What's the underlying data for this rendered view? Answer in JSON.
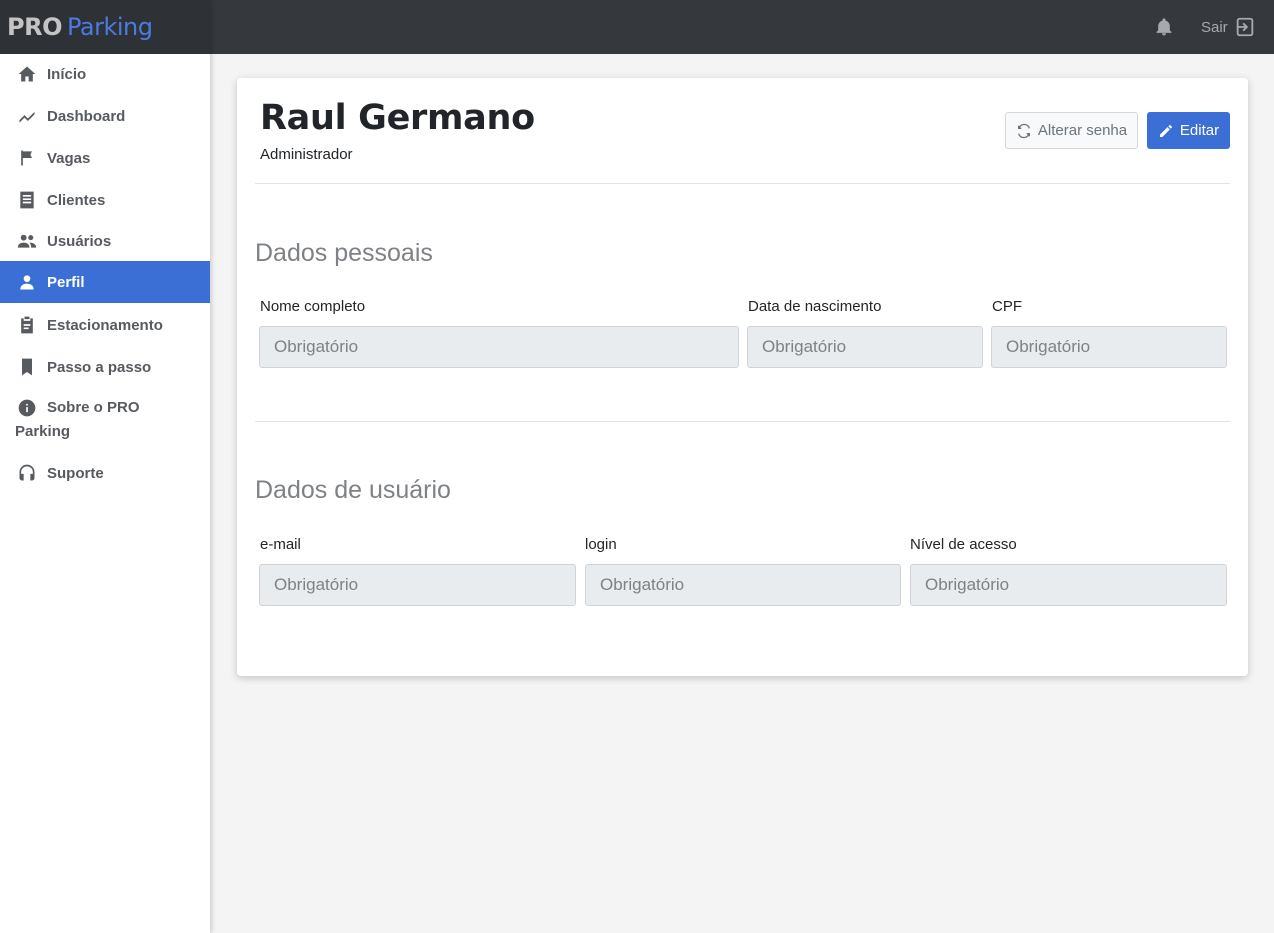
{
  "brand": {
    "pro": "PRO",
    "parking": "Parking"
  },
  "sidebar": {
    "items": [
      {
        "label": "Início",
        "icon": "home-icon"
      },
      {
        "label": "Dashboard",
        "icon": "chart-line-icon"
      },
      {
        "label": "Vagas",
        "icon": "flag-icon"
      },
      {
        "label": "Clientes",
        "icon": "list-icon"
      },
      {
        "label": "Usuários",
        "icon": "users-icon"
      },
      {
        "label": "Perfil",
        "icon": "user-icon",
        "active": true
      },
      {
        "label": "Estacionamento",
        "icon": "clipboard-icon"
      },
      {
        "label": "Passo a passo",
        "icon": "bookmark-icon"
      },
      {
        "label_line1": "Sobre o PRO",
        "label_line2": "Parking",
        "icon": "info-icon"
      },
      {
        "label": "Suporte",
        "icon": "headset-icon"
      }
    ]
  },
  "topbar": {
    "logout_label": "Sair",
    "bell_icon": "bell-icon",
    "logout_icon": "logout-icon"
  },
  "profile": {
    "name": "Raul Germano",
    "role": "Administrador",
    "change_password_label": "Alterar senha",
    "edit_label": "Editar"
  },
  "personal": {
    "title": "Dados pessoais",
    "full_name": {
      "label": "Nome completo",
      "placeholder": "Obrigatório"
    },
    "birth_date": {
      "label": "Data de nascimento",
      "placeholder": "Obrigatório"
    },
    "cpf": {
      "label": "CPF",
      "placeholder": "Obrigatório"
    }
  },
  "user_data": {
    "title": "Dados de usuário",
    "email": {
      "label": "e-mail",
      "placeholder": "Obrigatório"
    },
    "login": {
      "label": "login",
      "placeholder": "Obrigatório"
    },
    "access_level": {
      "label": "Nível de acesso",
      "placeholder": "Obrigatório"
    }
  },
  "colors": {
    "accent": "#3b6fd6",
    "topbar": "#35383c",
    "brand_bg": "#2e3135"
  }
}
